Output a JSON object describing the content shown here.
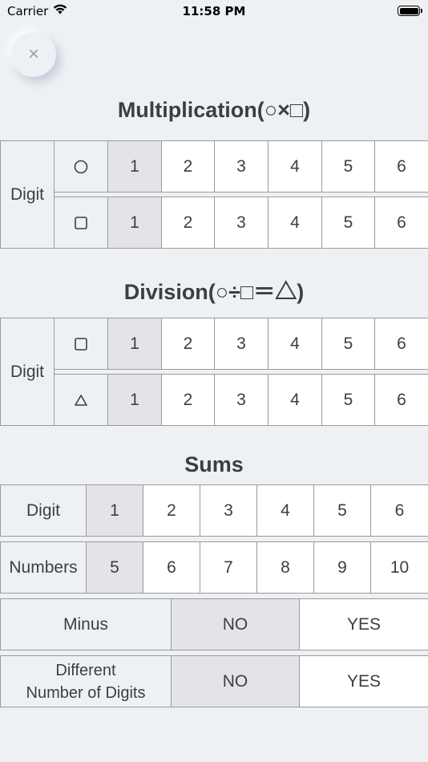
{
  "status_bar": {
    "carrier": "Carrier",
    "time": "11:58 PM"
  },
  "close_button": {
    "icon": "close-icon",
    "glyph": "×"
  },
  "multiplication": {
    "title": "Multiplication(○×□)",
    "row_label": "Digit",
    "rows": [
      {
        "symbol": "circle",
        "options": [
          "1",
          "2",
          "3",
          "4",
          "5",
          "6"
        ],
        "selected": "1"
      },
      {
        "symbol": "square",
        "options": [
          "1",
          "2",
          "3",
          "4",
          "5",
          "6"
        ],
        "selected": "1"
      }
    ]
  },
  "division": {
    "title": "Division(○÷□＝△)",
    "row_label": "Digit",
    "rows": [
      {
        "symbol": "square",
        "options": [
          "1",
          "2",
          "3",
          "4",
          "5",
          "6"
        ],
        "selected": "1"
      },
      {
        "symbol": "triangle",
        "options": [
          "1",
          "2",
          "3",
          "4",
          "5",
          "6"
        ],
        "selected": "1"
      }
    ]
  },
  "sums": {
    "title": "Sums",
    "digit": {
      "label": "Digit",
      "options": [
        "1",
        "2",
        "3",
        "4",
        "5",
        "6"
      ],
      "selected": "1"
    },
    "numbers": {
      "label": "Numbers",
      "options": [
        "5",
        "6",
        "7",
        "8",
        "9",
        "10"
      ],
      "selected": "5"
    },
    "minus": {
      "label": "Minus",
      "options": [
        "NO",
        "YES"
      ],
      "selected": "NO"
    },
    "different_digits": {
      "label_line1": "Different",
      "label_line2": "Number of Digits",
      "options": [
        "NO",
        "YES"
      ],
      "selected": "NO"
    }
  },
  "colors": {
    "background": "#eef1f4",
    "selected_cell": "#e4e4e8",
    "text": "#3a3f44",
    "border": "#9a9a9a"
  }
}
